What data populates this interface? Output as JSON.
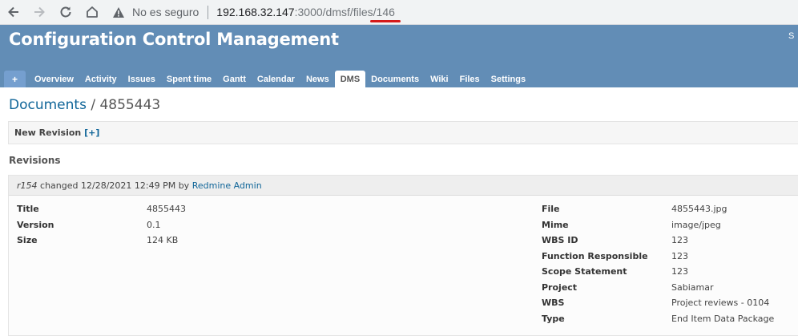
{
  "browser": {
    "security_label": "No es seguro",
    "host": "192.168.32.147",
    "port_path": ":3000/dmsf/files/",
    "highlighted_id": "146"
  },
  "header": {
    "title": "Configuration Control Management",
    "corner_text": "S"
  },
  "menu": {
    "add_label": "+",
    "tabs": [
      {
        "label": "Overview"
      },
      {
        "label": "Activity"
      },
      {
        "label": "Issues"
      },
      {
        "label": "Spent time"
      },
      {
        "label": "Gantt"
      },
      {
        "label": "Calendar"
      },
      {
        "label": "News"
      },
      {
        "label": "DMS"
      },
      {
        "label": "Documents"
      },
      {
        "label": "Wiki"
      },
      {
        "label": "Files"
      },
      {
        "label": "Settings"
      }
    ],
    "active_tab": "DMS"
  },
  "breadcrumb": {
    "parent": "Documents",
    "separator": " / ",
    "current": "4855443"
  },
  "new_revision": {
    "label": "New Revision",
    "toggle": "[+]"
  },
  "revisions": {
    "heading": "Revisions",
    "entry": {
      "revision": "r154",
      "changed_text": " changed 12/28/2021 12:49 PM by ",
      "author": "Redmine Admin",
      "left_fields": [
        {
          "label": "Title",
          "value": "4855443"
        },
        {
          "label": "Version",
          "value": "0.1"
        },
        {
          "label": "Size",
          "value": "124 KB"
        }
      ],
      "right_fields": [
        {
          "label": "File",
          "value": "4855443.jpg"
        },
        {
          "label": "Mime",
          "value": "image/jpeg"
        },
        {
          "label": "WBS ID",
          "value": "123"
        },
        {
          "label": "Function Responsible",
          "value": "123"
        },
        {
          "label": "Scope Statement",
          "value": "123"
        },
        {
          "label": "Project",
          "value": "Sabiamar"
        },
        {
          "label": "WBS",
          "value": "Project reviews - 0104"
        },
        {
          "label": "Type",
          "value": "End Item Data Package"
        }
      ]
    }
  },
  "colors": {
    "header_bg": "#628db6",
    "link": "#116699",
    "highlight_underline": "#d61a1a"
  }
}
